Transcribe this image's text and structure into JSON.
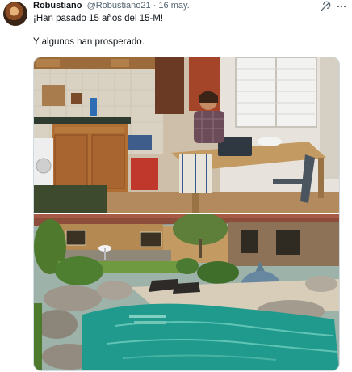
{
  "tweet": {
    "display_name": "Robustiano",
    "handle": "@Robustiano21",
    "separator": "·",
    "date": "16 may.",
    "text_line1": "¡Han pasado 15 años del 15-M!",
    "text_line2": "Y algunos han prosperado."
  },
  "icons": {
    "avatar": "avatar-image",
    "grok": "grok-icon",
    "more": "more-icon"
  },
  "media": {
    "photos": [
      "kitchen-photo",
      "pool-photo"
    ]
  },
  "colors": {
    "text": "#0f1419",
    "secondary_text": "#536471",
    "border": "#cfd9de",
    "background": "#ffffff"
  }
}
